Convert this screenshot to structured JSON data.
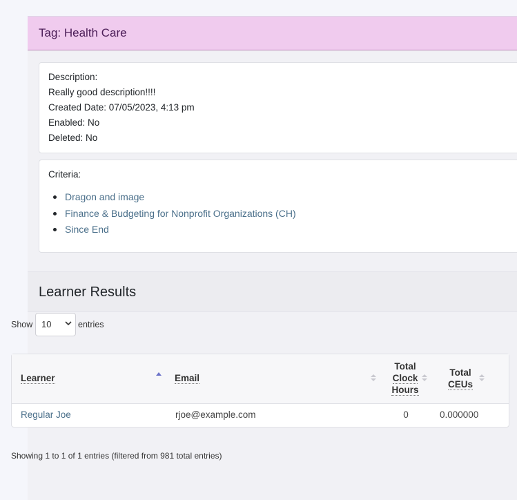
{
  "tag": {
    "title": "Tag: Health Care"
  },
  "details": {
    "description_label": "Description:",
    "description_text": "Really good description!!!!",
    "created": "Created Date: 07/05/2023, 4:13 pm",
    "enabled": "Enabled: No",
    "deleted": "Deleted: No"
  },
  "criteria": {
    "label": "Criteria:",
    "items": [
      "Dragon and image",
      "Finance & Budgeting for Nonprofit Organizations (CH)",
      "Since End"
    ]
  },
  "results": {
    "title": "Learner Results",
    "show_label": "Show",
    "entries_label": "entries",
    "page_size": "10",
    "columns": {
      "learner": "Learner",
      "email": "Email",
      "clock_1": "Total",
      "clock_2": "Clock",
      "clock_3": "Hours",
      "ceu_1": "Total",
      "ceu_2": "CEUs"
    },
    "rows": [
      {
        "learner": "Regular Joe",
        "email": "rjoe@example.com",
        "clock_hours": "0",
        "ceus": "0.000000"
      }
    ],
    "info": "Showing 1 to 1 of 1 entries (filtered from 981 total entries)"
  },
  "colors": {
    "header_bg": "#f0cbee",
    "header_text": "#4b1d57",
    "link": "#4a6f8a",
    "sort_active": "#6b72c9"
  }
}
